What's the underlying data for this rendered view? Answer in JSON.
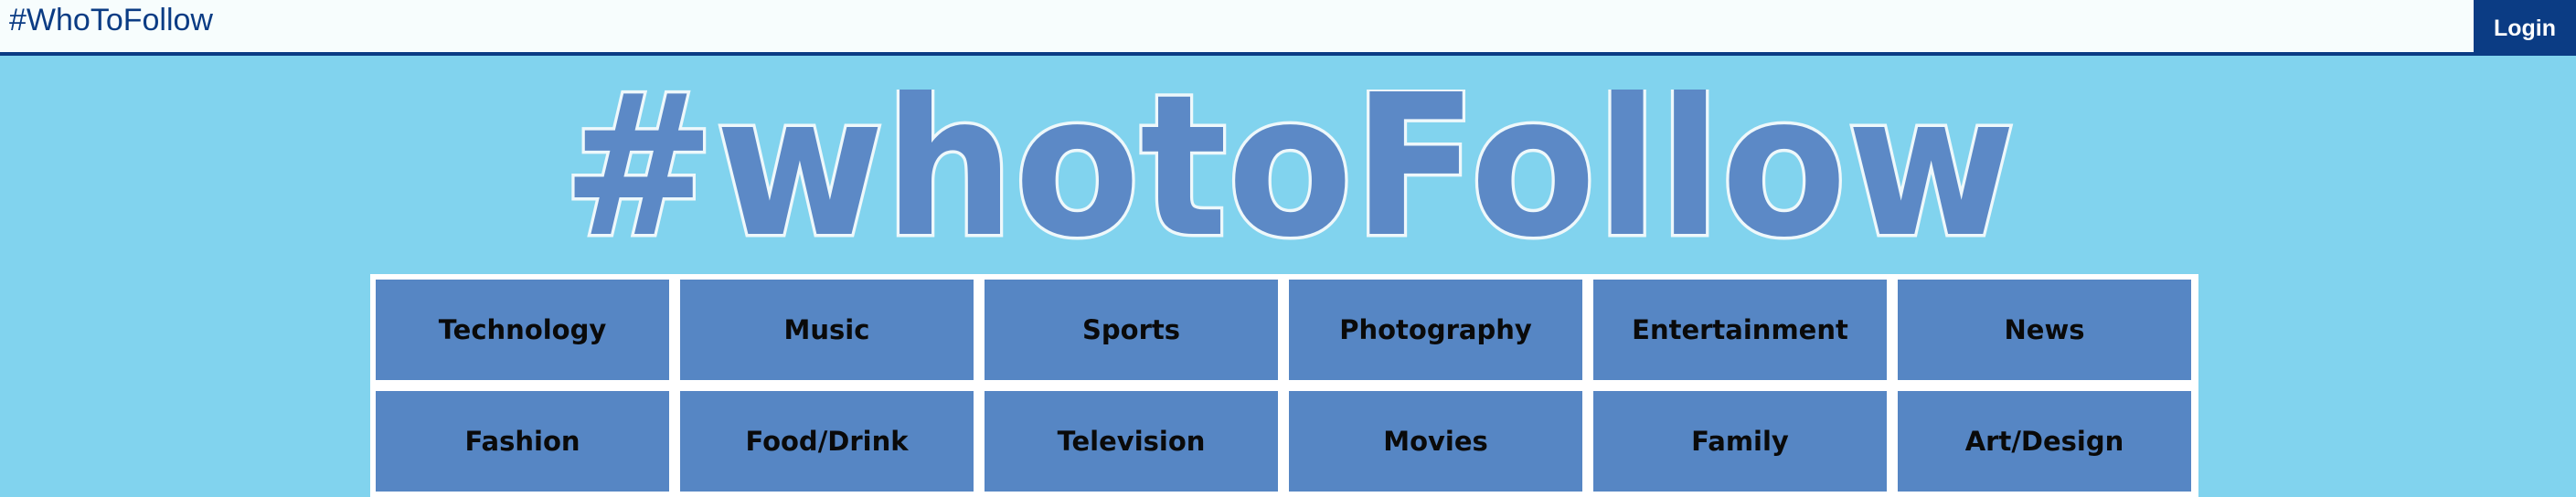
{
  "header": {
    "brand": "#WhoToFollow",
    "login_label": "Login"
  },
  "logo": {
    "text": "#whotoFollow"
  },
  "categories": [
    "Technology",
    "Music",
    "Sports",
    "Photography",
    "Entertainment",
    "News",
    "Fashion",
    "Food/Drink",
    "Television",
    "Movies",
    "Family",
    "Art/Design"
  ],
  "colors": {
    "background": "#81d3ee",
    "topbar": "#f7fdfd",
    "brand_blue": "#0b3c84",
    "tile": "#5686c4",
    "logo_fill": "#5c89c6",
    "logo_outline": "#eef8fb"
  }
}
